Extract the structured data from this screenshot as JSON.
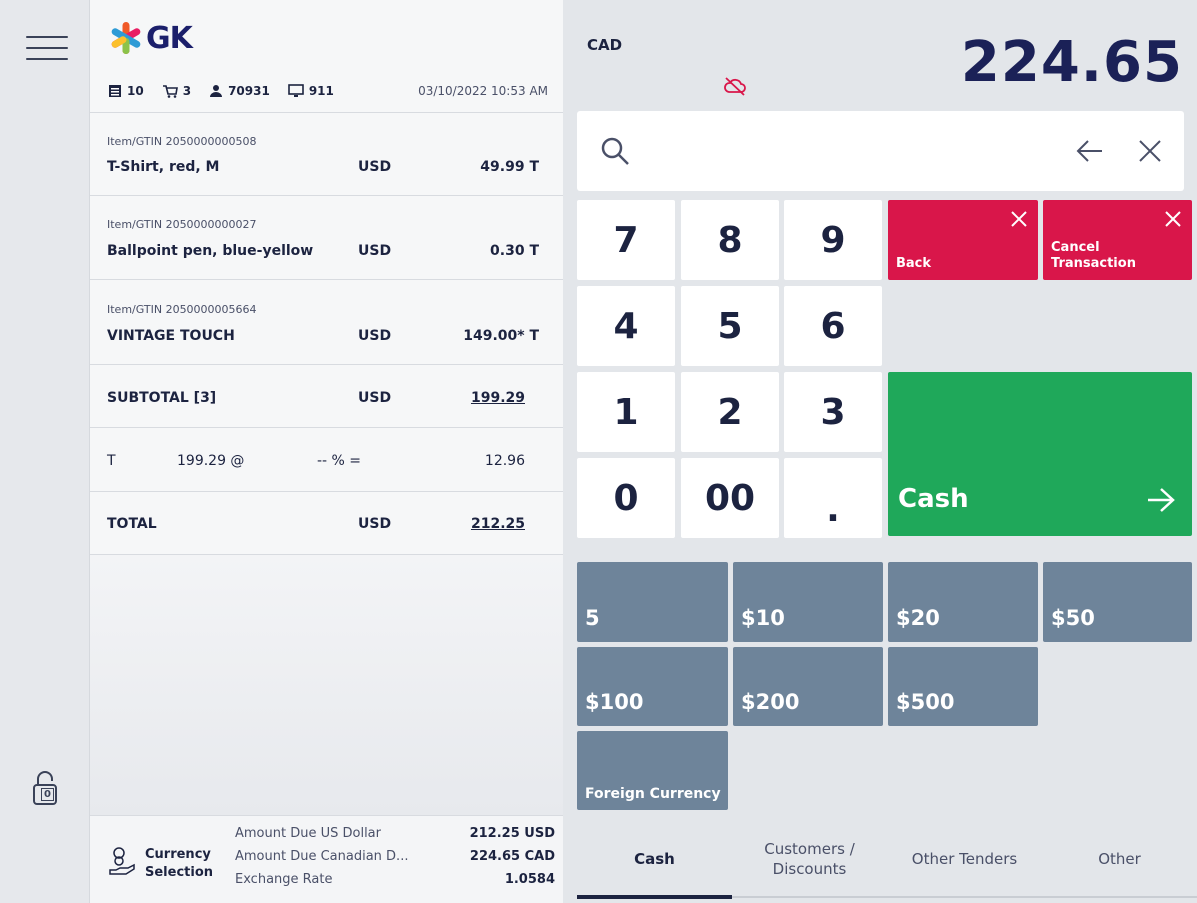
{
  "brand": {
    "logo_text": "GK"
  },
  "header_stats": {
    "receipts": "10",
    "cart": "3",
    "user": "70931",
    "workstation": "911",
    "datetime": "03/10/2022 10:53 AM"
  },
  "items": [
    {
      "gtin_label": "Item/GTIN 2050000000508",
      "description": "T-Shirt, red, M",
      "currency": "USD",
      "amount": "49.99  T"
    },
    {
      "gtin_label": "Item/GTIN 2050000000027",
      "description": "Ballpoint pen, blue-yellow",
      "currency": "USD",
      "amount": "0.30  T"
    },
    {
      "gtin_label": "Item/GTIN 2050000005664",
      "description": "VINTAGE TOUCH",
      "currency": "USD",
      "amount": "149.00* T"
    }
  ],
  "subtotal": {
    "label": "SUBTOTAL [3]",
    "currency": "USD",
    "amount": "199.29"
  },
  "tax": {
    "code": "T",
    "base": "199.29 @",
    "rate": "-- % =",
    "amount": "12.96"
  },
  "total": {
    "label": "TOTAL",
    "currency": "USD",
    "amount": "212.25"
  },
  "currency_selection": {
    "label_line1": "Currency",
    "label_line2": "Selection",
    "rows": [
      {
        "label": "Amount Due US Dollar",
        "value": "212.25 USD"
      },
      {
        "label": "Amount Due Canadian D...",
        "value": "224.65 CAD"
      },
      {
        "label": "Exchange Rate",
        "value": "1.0584"
      }
    ]
  },
  "display": {
    "currency": "CAD",
    "amount": "224.65"
  },
  "keypad": {
    "k7": "7",
    "k8": "8",
    "k9": "9",
    "k4": "4",
    "k5": "5",
    "k6": "6",
    "k1": "1",
    "k2": "2",
    "k3": "3",
    "k0": "0",
    "k00": "00",
    "kdot": "."
  },
  "actions": {
    "back": "Back",
    "cancel_line1": "Cancel",
    "cancel_line2": "Transaction",
    "cash": "Cash"
  },
  "tender_buttons": {
    "t5": "5",
    "t10": "$10",
    "t20": "$20",
    "t50": "$50",
    "t100": "$100",
    "t200": "$200",
    "t500": "$500",
    "foreign": "Foreign Currency"
  },
  "tabs": {
    "cash": "Cash",
    "customers_line1": "Customers /",
    "customers_line2": "Discounts",
    "other_tenders": "Other Tenders",
    "other": "Other"
  },
  "lock": {
    "count": "0"
  },
  "colors": {
    "cancel_red": "#d9164a",
    "cash_green": "#1fa85a",
    "tender_slate": "#6e849a",
    "navy": "#1b2157"
  },
  "icons": {
    "menu": "hamburger-icon",
    "lock": "lock-icon",
    "search": "search-icon",
    "backspace": "arrow-left-icon",
    "clear": "close-icon",
    "offline": "cloud-off-icon",
    "cash_arrow": "arrow-right-icon"
  }
}
